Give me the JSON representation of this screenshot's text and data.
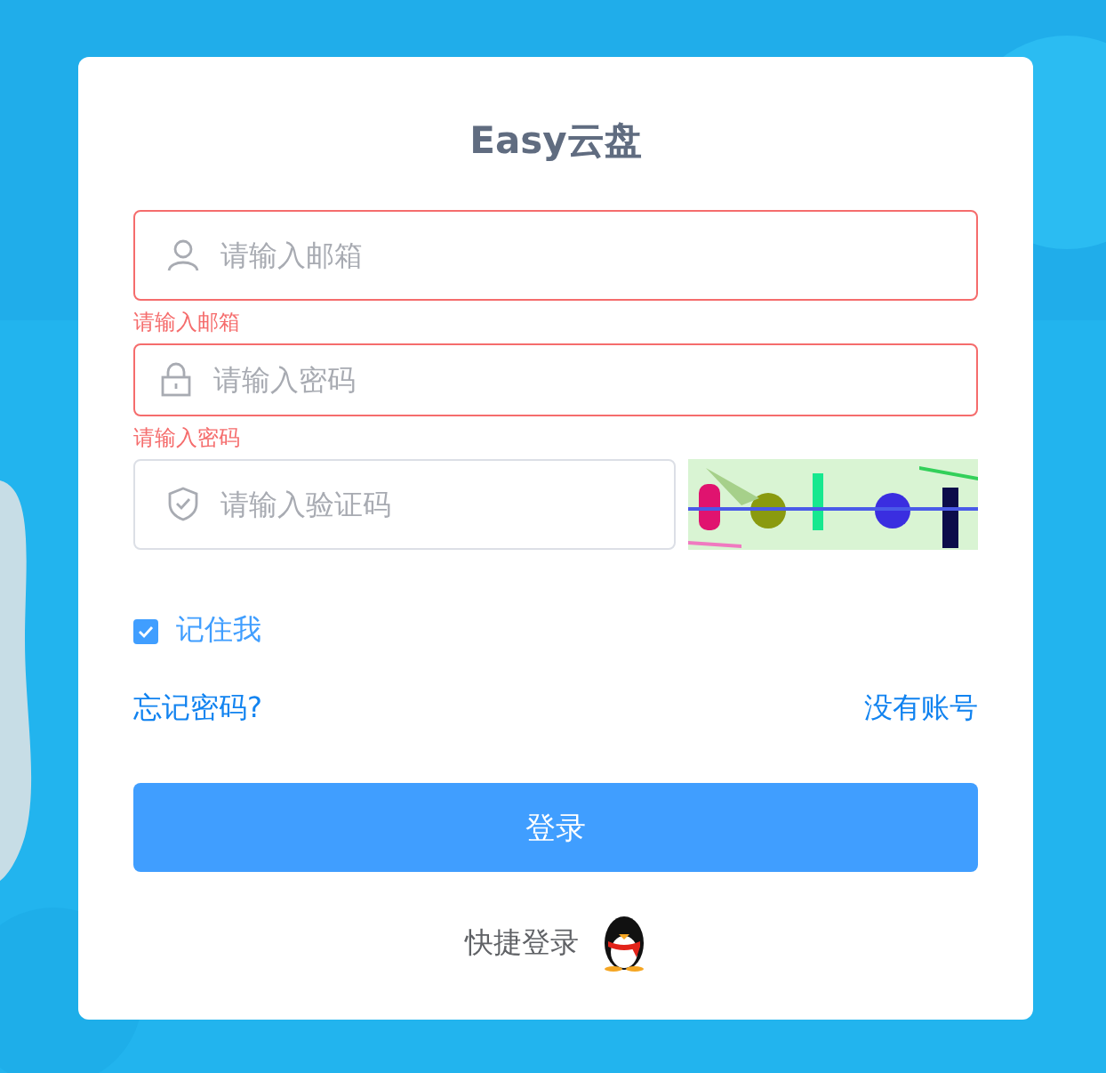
{
  "title": "Easy云盘",
  "fields": [
    {
      "kind": "email",
      "placeholder": "请输入邮箱",
      "error": "请输入邮箱"
    },
    {
      "kind": "password",
      "placeholder": "请输入密码",
      "error": "请输入密码"
    },
    {
      "kind": "captcha",
      "placeholder": "请输入验证码"
    }
  ],
  "remember": {
    "label": "记住我",
    "checked": true
  },
  "links": [
    "忘记密码?",
    "没有账号"
  ],
  "login_button": "登录",
  "quick_login": "快捷登录"
}
